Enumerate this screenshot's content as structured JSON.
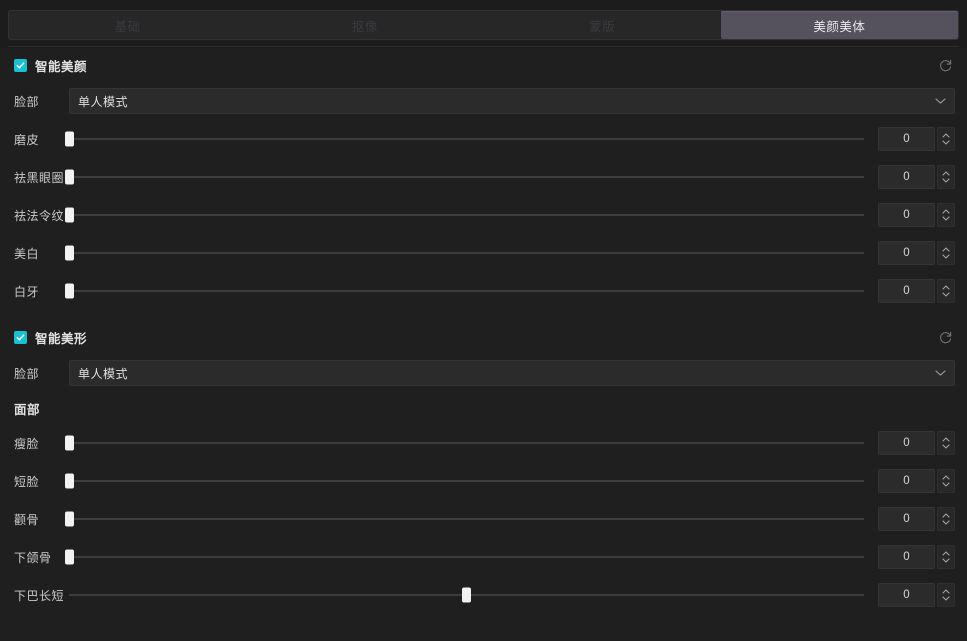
{
  "tabs": [
    {
      "label": "基础",
      "active": false
    },
    {
      "label": "抠像",
      "active": false
    },
    {
      "label": "蒙版",
      "active": false
    },
    {
      "label": "美颜美体",
      "active": true
    }
  ],
  "colors": {
    "accent": "#19c0d4",
    "panel_bg": "#1f1f1f",
    "tab_active_bg": "#55525e",
    "field_bg": "#2b2b2b",
    "slider_track": "#5b5b5b",
    "slider_thumb": "#f2f2f2"
  },
  "sections": [
    {
      "title": "智能美颜",
      "checked": true,
      "reset_icon": "reset-icon",
      "select": {
        "label": "脸部",
        "value": "单人模式",
        "chevron_icon": "chevron-down-icon"
      },
      "sliders": [
        {
          "label": "磨皮",
          "value": "0",
          "percent": 0
        },
        {
          "label": "祛黑眼圈",
          "value": "0",
          "percent": 0
        },
        {
          "label": "祛法令纹",
          "value": "0",
          "percent": 0
        },
        {
          "label": "美白",
          "value": "0",
          "percent": 0
        },
        {
          "label": "白牙",
          "value": "0",
          "percent": 0
        }
      ]
    },
    {
      "title": "智能美形",
      "checked": true,
      "reset_icon": "reset-icon",
      "select": {
        "label": "脸部",
        "value": "单人模式",
        "chevron_icon": "chevron-down-icon"
      },
      "subhead": "面部",
      "sliders": [
        {
          "label": "瘦脸",
          "value": "0",
          "percent": 0
        },
        {
          "label": "短脸",
          "value": "0",
          "percent": 0
        },
        {
          "label": "颧骨",
          "value": "0",
          "percent": 0
        },
        {
          "label": "下颌骨",
          "value": "0",
          "percent": 0
        },
        {
          "label": "下巴长短",
          "value": "0",
          "percent": 50
        }
      ]
    }
  ]
}
